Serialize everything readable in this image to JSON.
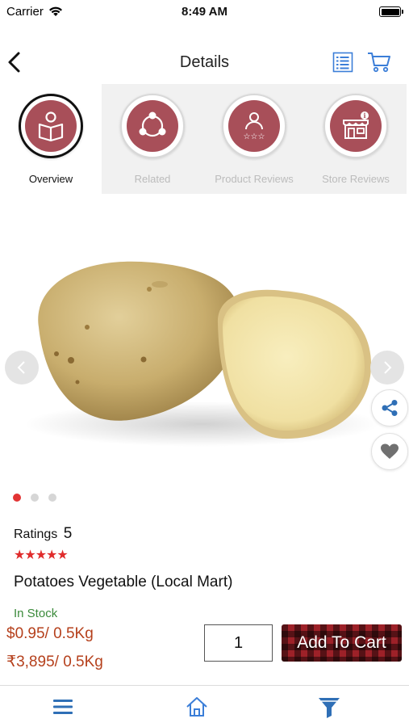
{
  "status_bar": {
    "carrier": "Carrier",
    "time": "8:49 AM"
  },
  "header": {
    "title": "Details"
  },
  "tabs": [
    {
      "label": "Overview",
      "icon": "reader-icon",
      "active": true
    },
    {
      "label": "Related",
      "icon": "network-icon",
      "active": false
    },
    {
      "label": "Product Reviews",
      "icon": "rated-user-icon",
      "active": false
    },
    {
      "label": "Store Reviews",
      "icon": "store-icon",
      "active": false
    }
  ],
  "carousel": {
    "slides": 3,
    "active_index": 0
  },
  "product": {
    "ratings_label": "Ratings",
    "rating_value": "5",
    "stars": "★★★★★",
    "name": "Potatoes Vegetable (Local Mart)",
    "stock": "In Stock",
    "price_primary": "$0.95/ 0.5Kg",
    "price_secondary": "₹3,895/ 0.5Kg"
  },
  "cart": {
    "quantity": "1",
    "add_label": "Add To Cart"
  },
  "colors": {
    "accent": "#a84f59",
    "price": "#b5401c",
    "star": "#e02c2c",
    "nav_icon": "#3b7ed8"
  }
}
